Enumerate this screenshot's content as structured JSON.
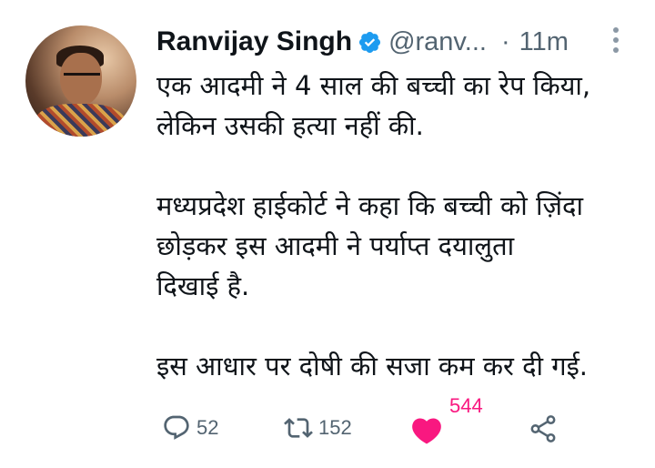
{
  "author": {
    "name": "Ranvijay Singh",
    "handle": "@ranv...",
    "separator": "·",
    "time": "11m"
  },
  "tweet": {
    "lines_p1": [
      "एक आदमी ने 4 साल की बच्ची का रेप किया,",
      "लेकिन उसकी हत्या नहीं की."
    ],
    "lines_p2": [
      "मध्यप्रदेश हाईकोर्ट ने कहा कि बच्ची को ज़िंदा",
      "छोड़कर इस आदमी ने पर्याप्त दयालुता",
      "दिखाई है."
    ],
    "lines_p3": [
      "इस आधार पर दोषी की सजा कम कर दी गई."
    ]
  },
  "actions": {
    "reply_count": "52",
    "retweet_count": "152",
    "like_count": "544"
  },
  "colors": {
    "text": "#0f1419",
    "secondary": "#536471",
    "verified": "#1d9bf0",
    "like": "#f91880"
  },
  "icons": {
    "verified": "verified-badge-icon",
    "more": "more-vertical-icon",
    "reply": "reply-icon",
    "retweet": "retweet-icon",
    "like": "heart-filled-icon",
    "share": "share-icon"
  }
}
